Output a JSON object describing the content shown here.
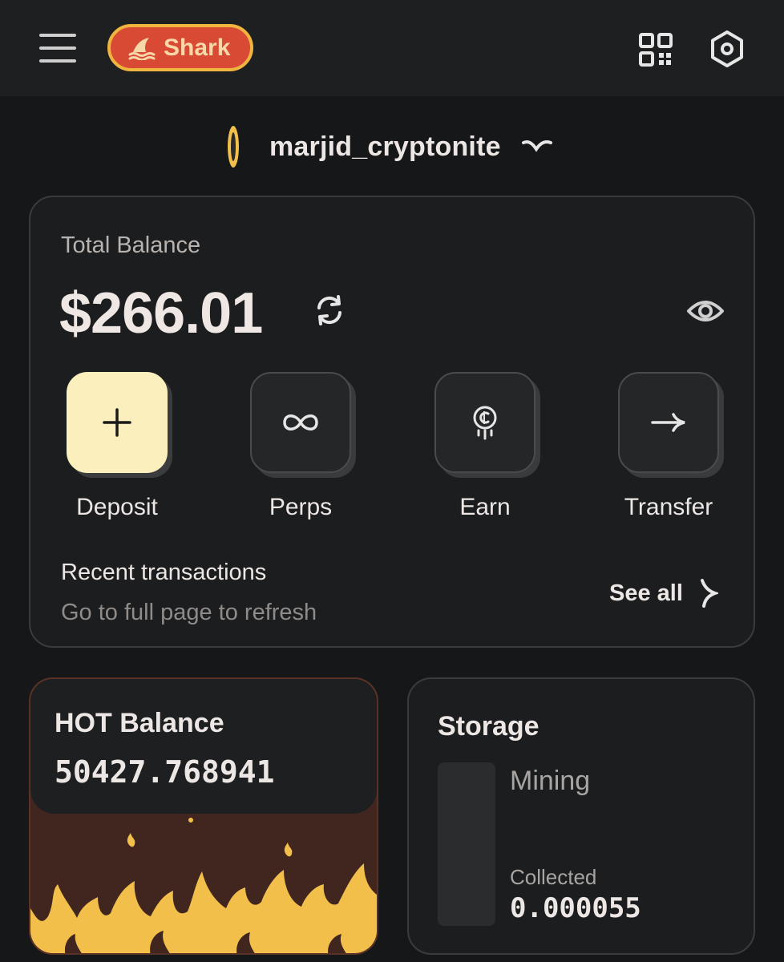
{
  "header": {
    "app_badge": "Shark",
    "menu_icon": "hamburger-menu-icon",
    "qr_icon": "qr-code-icon",
    "settings_icon": "hexagon-settings-icon"
  },
  "account": {
    "username": "marjid_cryptonite"
  },
  "balance": {
    "label": "Total Balance",
    "value": "$266.01"
  },
  "actions": [
    {
      "label": "Deposit",
      "icon": "plus-icon"
    },
    {
      "label": "Perps",
      "icon": "infinity-icon"
    },
    {
      "label": "Earn",
      "icon": "coin-icon"
    },
    {
      "label": "Transfer",
      "icon": "arrow-right-icon"
    }
  ],
  "recent": {
    "title": "Recent transactions",
    "subtitle": "Go to full page to refresh",
    "see_all": "See all"
  },
  "hot": {
    "title": "HOT Balance",
    "value": "50427.768941"
  },
  "storage": {
    "title": "Storage",
    "status": "Mining",
    "collected_label": "Collected",
    "collected_value": "0.000055"
  },
  "colors": {
    "background": "#161718",
    "card": "#1c1d1f",
    "deposit_tile": "#fbefbd",
    "shark_badge": "#d94a34",
    "shark_border": "#f0b53f",
    "fire": "#f2c04a",
    "hot_bg": "#40261e"
  }
}
